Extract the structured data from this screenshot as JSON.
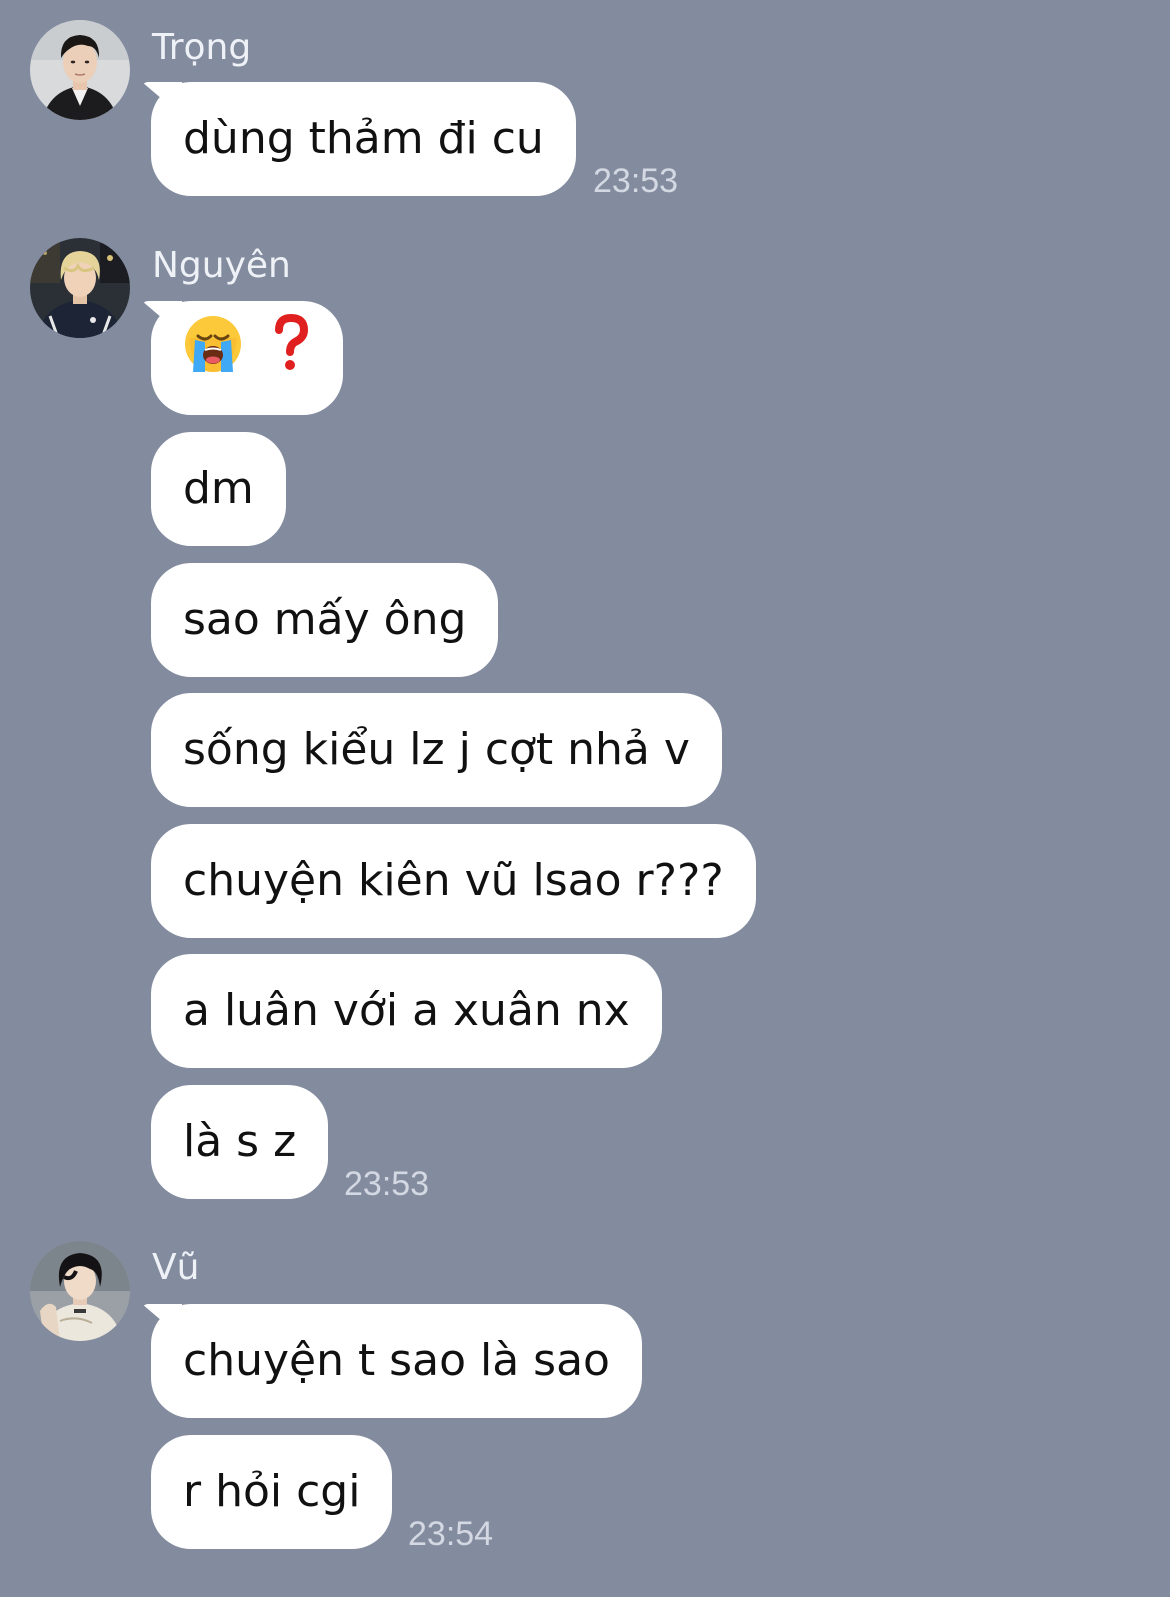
{
  "conversation": [
    {
      "sender": "Trọng",
      "messages": [
        "dùng thảm đi cu"
      ],
      "time": "23:53"
    },
    {
      "sender": "Nguyên",
      "messages": [
        "😭❓",
        "dm",
        "sao mấy ông",
        "sống kiểu lz j cợt nhả v",
        "chuyện kiên vũ lsao r???",
        "a luân với a xuân nx",
        "là s z"
      ],
      "time": "23:53"
    },
    {
      "sender": "Vũ",
      "messages": [
        "chuyện t sao là sao",
        "r hỏi cgi"
      ],
      "time": "23:54"
    }
  ],
  "emoji_names": [
    "loudly-crying-face-icon",
    "red-question-mark-icon"
  ],
  "colors": {
    "background": "#838c9f",
    "bubble": "#ffffff",
    "sender_name": "#eef1f6",
    "timestamp": "#d3d8e2"
  }
}
